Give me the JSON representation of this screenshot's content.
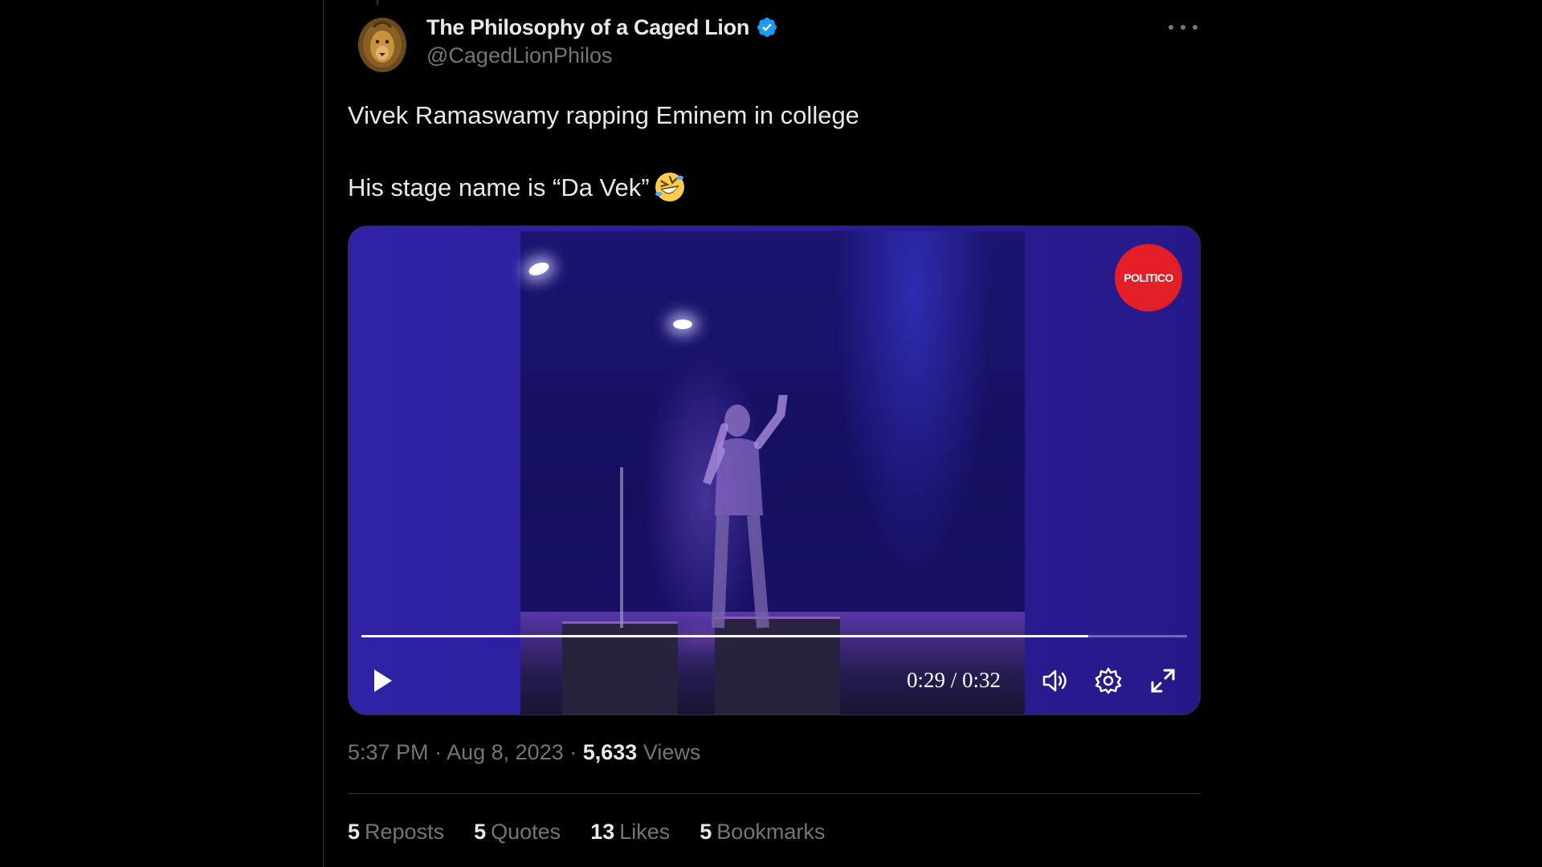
{
  "author": {
    "display_name": "The Philosophy of a Caged Lion",
    "handle": "@CagedLionPhilos",
    "verified_icon": "verified-badge-icon",
    "avatar_icon": "lion-avatar"
  },
  "more_icon": "more-options-icon",
  "tweet": {
    "line1": "Vivek Ramaswamy rapping Eminem in college",
    "line2": "His stage name is “Da Vek”",
    "emoji": "rolling-on-floor-laughing-emoji"
  },
  "media": {
    "watermark": "POLITICO",
    "current_time": "0:29",
    "duration": "0:32",
    "time_display": "0:29 / 0:32",
    "progress_fraction": 0.88,
    "controls": [
      "play-icon",
      "volume-icon",
      "settings-icon",
      "fullscreen-icon"
    ]
  },
  "meta": {
    "time": "5:37 PM",
    "date": "Aug 8, 2023",
    "views_count": "5,633",
    "views_label": "Views"
  },
  "stats": [
    {
      "count": "5",
      "label": "Reposts"
    },
    {
      "count": "5",
      "label": "Quotes"
    },
    {
      "count": "13",
      "label": "Likes"
    },
    {
      "count": "5",
      "label": "Bookmarks"
    }
  ],
  "colors": {
    "background": "#000000",
    "text_primary": "#e7e9ea",
    "text_secondary": "#71767b",
    "verified": "#1d9bf0",
    "politico_red": "#e41e26"
  }
}
